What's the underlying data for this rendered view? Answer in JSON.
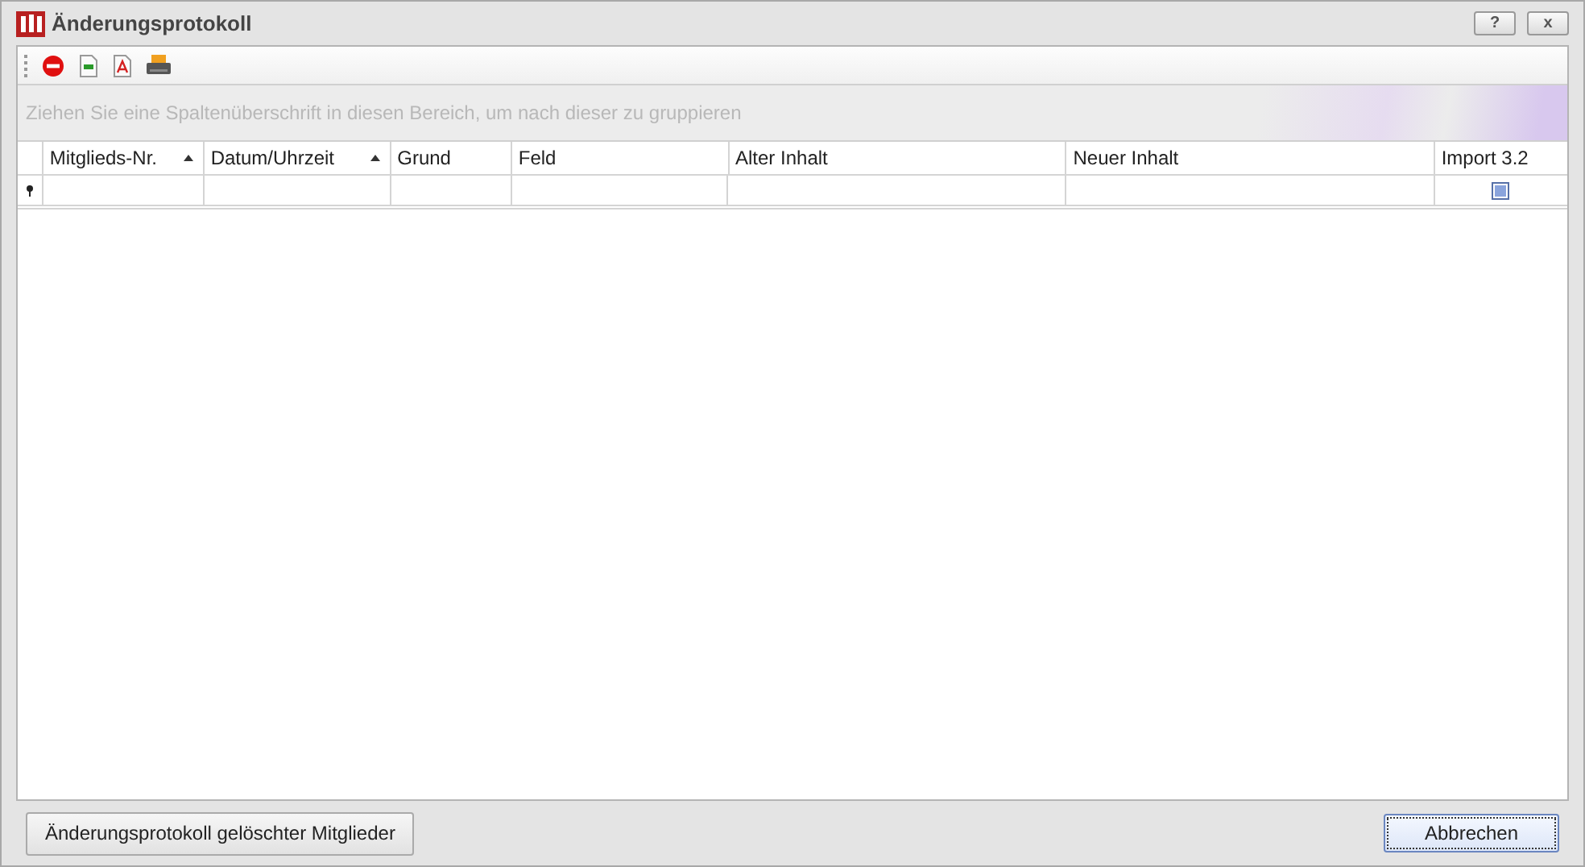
{
  "window": {
    "title": "Änderungsprotokoll",
    "buttons": [
      "?",
      "x"
    ]
  },
  "toolbar": [
    {
      "kind": "stop"
    },
    {
      "kind": "csv"
    },
    {
      "kind": "pdf"
    },
    {
      "kind": "print"
    }
  ],
  "group_panel": {
    "hint": "Ziehen Sie eine Spaltenüberschrift in diesen Bereich, um nach dieser zu gruppieren"
  },
  "table": {
    "columns": [
      {
        "label": "Mitglieds-Nr.",
        "sorted_ascending": true
      },
      {
        "label": "Datum/Uhrzeit",
        "sorted_ascending": true
      },
      {
        "label": "Grund",
        "sorted_ascending": false
      },
      {
        "label": "Feld",
        "sorted_ascending": false
      },
      {
        "label": "Alter Inhalt",
        "sorted_ascending": false
      },
      {
        "label": "Neuer Inhalt",
        "sorted_ascending": false
      },
      {
        "label": "Import 3.2",
        "sorted_ascending": false,
        "filter_checkbox": {
          "indeterminate": true
        }
      }
    ]
  },
  "footer": {
    "buttons": [
      {
        "label": "Änderungsprotokoll gelöschter Mitglieder",
        "default": false
      },
      {
        "label": "Abbrechen",
        "default": true
      }
    ]
  }
}
